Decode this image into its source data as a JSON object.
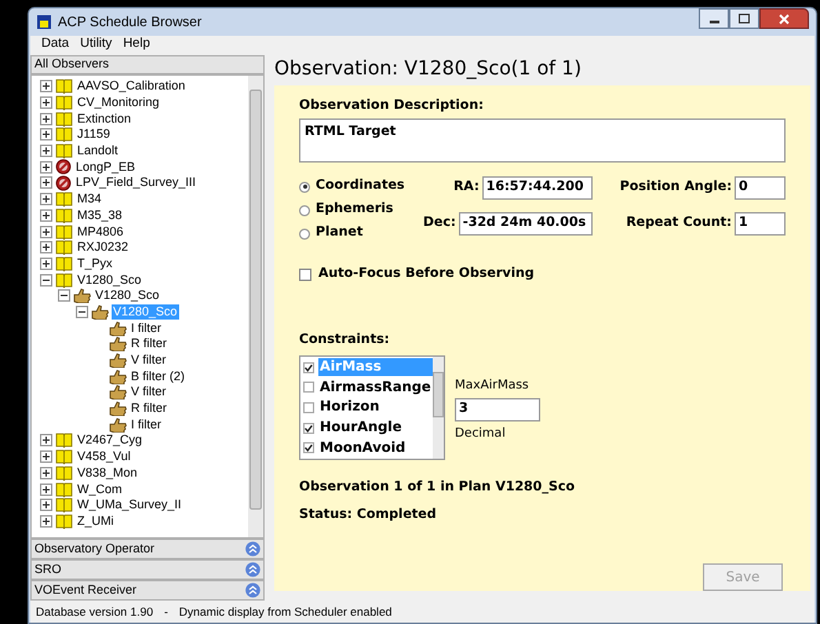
{
  "window": {
    "title": "ACP Schedule Browser"
  },
  "menu": [
    "Data",
    "Utility",
    "Help"
  ],
  "sidebar": {
    "header": "All Observers",
    "tree": [
      {
        "label": "AAVSO_Calibration",
        "kind": "plan",
        "expanded": false,
        "selected": false
      },
      {
        "label": "CV_Monitoring",
        "kind": "plan",
        "expanded": false,
        "selected": false
      },
      {
        "label": "Extinction",
        "kind": "plan",
        "expanded": false,
        "selected": false
      },
      {
        "label": "J1159",
        "kind": "plan",
        "expanded": false,
        "selected": false
      },
      {
        "label": "Landolt",
        "kind": "plan",
        "expanded": false,
        "selected": false
      },
      {
        "label": "LongP_EB",
        "kind": "disabled",
        "expanded": false,
        "selected": false
      },
      {
        "label": "LPV_Field_Survey_III",
        "kind": "disabled",
        "expanded": false,
        "selected": false
      },
      {
        "label": "M34",
        "kind": "plan",
        "expanded": false,
        "selected": false
      },
      {
        "label": "M35_38",
        "kind": "plan",
        "expanded": false,
        "selected": false
      },
      {
        "label": "MP4806",
        "kind": "plan",
        "expanded": false,
        "selected": false
      },
      {
        "label": "RXJ0232",
        "kind": "plan",
        "expanded": false,
        "selected": false
      },
      {
        "label": "T_Pyx",
        "kind": "plan",
        "expanded": false,
        "selected": false
      },
      {
        "label": "V1280_Sco",
        "kind": "plan",
        "expanded": true,
        "selected": false,
        "children": [
          {
            "label": "V1280_Sco",
            "kind": "observation",
            "expanded": true,
            "selected": false,
            "children": [
              {
                "label": "V1280_Sco",
                "kind": "observation",
                "expanded": true,
                "selected": true,
                "children": [
                  {
                    "label": "I filter",
                    "kind": "observation",
                    "selected": false
                  },
                  {
                    "label": "R filter",
                    "kind": "observation",
                    "selected": false
                  },
                  {
                    "label": "V filter",
                    "kind": "observation",
                    "selected": false
                  },
                  {
                    "label": "B filter (2)",
                    "kind": "observation",
                    "selected": false
                  },
                  {
                    "label": "V filter",
                    "kind": "observation",
                    "selected": false
                  },
                  {
                    "label": "R filter",
                    "kind": "observation",
                    "selected": false
                  },
                  {
                    "label": "I filter",
                    "kind": "observation",
                    "selected": false
                  }
                ]
              }
            ]
          }
        ]
      },
      {
        "label": "V2467_Cyg",
        "kind": "plan",
        "expanded": false,
        "selected": false
      },
      {
        "label": "V458_Vul",
        "kind": "plan",
        "expanded": false,
        "selected": false
      },
      {
        "label": "V838_Mon",
        "kind": "plan",
        "expanded": false,
        "selected": false
      },
      {
        "label": "W_Com",
        "kind": "plan",
        "expanded": false,
        "selected": false
      },
      {
        "label": "W_UMa_Survey_II",
        "kind": "plan",
        "expanded": false,
        "selected": false
      },
      {
        "label": "Z_UMi",
        "kind": "plan",
        "expanded": false,
        "selected": false
      }
    ],
    "panels": [
      "Observatory Operator",
      "SRO",
      "VOEvent Receiver"
    ]
  },
  "detail": {
    "heading": "Observation: V1280_Sco(1 of 1)",
    "description_label": "Observation Description:",
    "description": "RTML Target",
    "target_types": [
      {
        "label": "Coordinates",
        "selected": true
      },
      {
        "label": "Ephemeris",
        "selected": false
      },
      {
        "label": "Planet",
        "selected": false
      }
    ],
    "ra_label": "RA:",
    "ra": "16:57:44.200",
    "dec_label": "Dec:",
    "dec": "-32d 24m 40.00s",
    "position_angle_label": "Position Angle:",
    "position_angle": "0",
    "repeat_count_label": "Repeat Count:",
    "repeat_count": "1",
    "auto_focus": {
      "label": "Auto-Focus Before Observing",
      "checked": false
    },
    "constraints_label": "Constraints:",
    "constraints": [
      {
        "label": "AirMass",
        "checked": true,
        "selected": true
      },
      {
        "label": "AirmassRange",
        "checked": false,
        "selected": false
      },
      {
        "label": "Horizon",
        "checked": false,
        "selected": false
      },
      {
        "label": "HourAngle",
        "checked": true,
        "selected": false
      },
      {
        "label": "MoonAvoid",
        "checked": true,
        "selected": false
      }
    ],
    "param_label": "MaxAirMass",
    "param_value": "3",
    "param_type": "Decimal",
    "plan_info": "Observation 1 of 1 in Plan V1280_Sco",
    "status": "Status: Completed",
    "save_button": {
      "label": "Save",
      "disabled": true
    }
  },
  "status_bar": [
    "Database version 1.90",
    "-",
    "Dynamic display from Scheduler enabled"
  ]
}
